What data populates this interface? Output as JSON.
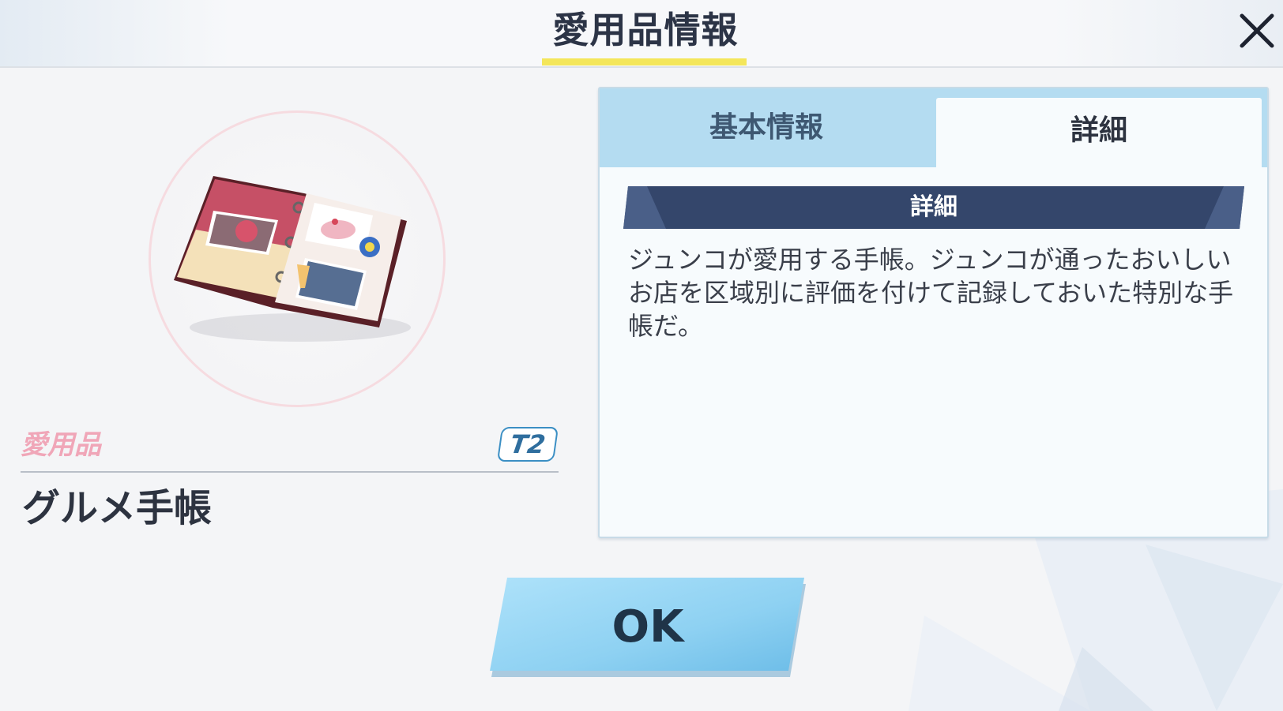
{
  "header": {
    "title": "愛用品情報",
    "close_icon": "close-icon"
  },
  "item": {
    "category_label": "愛用品",
    "tier_badge": "T2",
    "name": "グルメ手帳",
    "image_icon": "notebook-icon"
  },
  "panel": {
    "tabs": [
      {
        "label": "基本情報",
        "active": false
      },
      {
        "label": "詳細",
        "active": true
      }
    ],
    "section_title": "詳細",
    "description": "ジュンコが愛用する手帳。ジュンコが通ったおいしいお店を区域別に評価を付けて記録しておいた特別な手帳だ。"
  },
  "actions": {
    "ok_label": "OK"
  },
  "colors": {
    "accent_yellow": "#f4e65a",
    "tab_bar": "#b4dcf1",
    "section_bar": "#34466b",
    "ok_button": "#8fd0f2",
    "category_pink": "#f0a6b8"
  }
}
